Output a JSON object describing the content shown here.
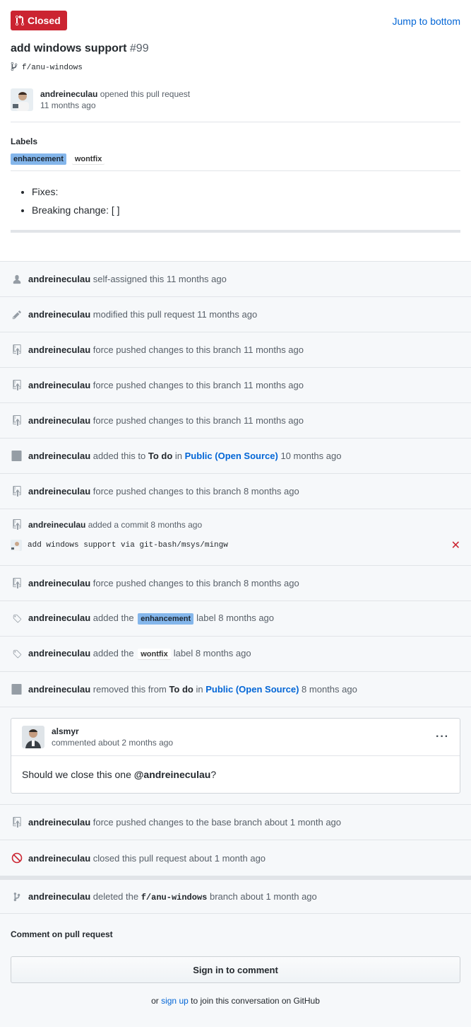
{
  "header": {
    "state_label": "Closed",
    "jump_label": "Jump to bottom",
    "title": "add windows support",
    "number": "#99",
    "branch": "f/anu-windows"
  },
  "opener": {
    "author": "andreineculau",
    "action": "opened this pull request",
    "time": "11 months ago"
  },
  "labels": {
    "heading": "Labels",
    "items": [
      "enhancement",
      "wontfix"
    ]
  },
  "body": {
    "bullets": [
      "Fixes:",
      "Breaking change: [ ]"
    ]
  },
  "timeline": [
    {
      "icon": "person-icon",
      "actor": "andreineculau",
      "text": "self-assigned this 11 months ago"
    },
    {
      "icon": "pencil-icon",
      "actor": "andreineculau",
      "text": "modified this pull request 11 months ago"
    },
    {
      "icon": "repo-push-icon",
      "actor": "andreineculau",
      "text": "force pushed changes to this branch 11 months ago"
    },
    {
      "icon": "repo-push-icon",
      "actor": "andreineculau",
      "text": "force pushed changes to this branch 11 months ago"
    },
    {
      "icon": "repo-push-icon",
      "actor": "andreineculau",
      "text": "force pushed changes to this branch 11 months ago"
    },
    {
      "icon": "project-icon",
      "actor": "andreineculau",
      "pre": "added this to",
      "column": "To do",
      "mid": "in",
      "project": "Public (Open Source)",
      "post": "10 months ago"
    },
    {
      "icon": "repo-push-icon",
      "actor": "andreineculau",
      "text": "force pushed changes to this branch 8 months ago"
    }
  ],
  "commit_event": {
    "actor": "andreineculau",
    "text": "added a commit 8 months ago",
    "message": "add windows support via git-bash/msys/mingw",
    "status": "✕"
  },
  "timeline2": [
    {
      "icon": "repo-push-icon",
      "actor": "andreineculau",
      "text": "force pushed changes to this branch 8 months ago"
    },
    {
      "icon": "tag-icon",
      "actor": "andreineculau",
      "pre": "added the",
      "label": "enhancement",
      "post": "label 8 months ago"
    },
    {
      "icon": "tag-icon",
      "actor": "andreineculau",
      "pre": "added the",
      "label": "wontfix",
      "post": "label 8 months ago"
    },
    {
      "icon": "project-icon",
      "actor": "andreineculau",
      "pre": "removed this from",
      "column": "To do",
      "mid": "in",
      "project": "Public (Open Source)",
      "post": "8 months ago"
    }
  ],
  "comment": {
    "author": "alsmyr",
    "time": "commented about 2 months ago",
    "menu": "···",
    "text_pre": "Should we close this one",
    "mention": "@andreineculau",
    "text_post": "?"
  },
  "timeline3": [
    {
      "icon": "repo-push-icon",
      "actor": "andreineculau",
      "text": "force pushed changes to the base branch about 1 month ago"
    },
    {
      "icon": "circle-slash-icon",
      "actor": "andreineculau",
      "text": "closed this pull request about 1 month ago"
    }
  ],
  "deleted": {
    "actor": "andreineculau",
    "pre": "deleted the",
    "branch": "f/anu-windows",
    "post": "branch about 1 month ago"
  },
  "footer": {
    "heading": "Comment on pull request",
    "button": "Sign in to comment",
    "or": "or",
    "signup": "sign up",
    "tail": "to join this conversation on GitHub"
  },
  "colors": {
    "closed": "#cb2431",
    "link": "#0366d6",
    "enhancement": "#84b6eb"
  }
}
